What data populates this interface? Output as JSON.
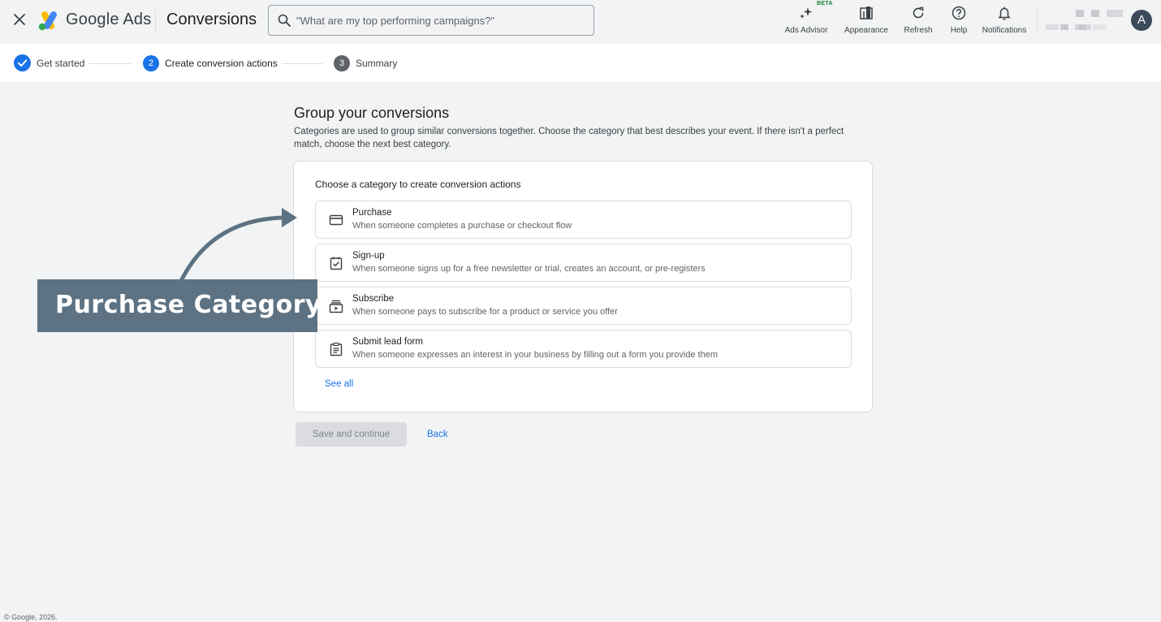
{
  "header": {
    "product_name": "Google Ads",
    "page_name": "Conversions",
    "search_placeholder": "\"What are my top performing campaigns?\"",
    "tools": [
      {
        "label": "Ads Advisor",
        "icon": "sparkle-icon"
      },
      {
        "label": "Appearance",
        "icon": "appearance-icon"
      },
      {
        "label": "Refresh",
        "icon": "refresh-icon"
      },
      {
        "label": "Help",
        "icon": "help-icon"
      },
      {
        "label": "Notifications",
        "icon": "bell-icon"
      }
    ],
    "beta_badge": "BETA",
    "avatar_letter": "A",
    "colors": {
      "google_blue": "#4285f4",
      "google_red": "#ea4335",
      "google_yellow": "#fbbc04",
      "google_green": "#34a853"
    }
  },
  "stepper": {
    "steps": [
      {
        "number": "1",
        "label": "Get started",
        "state": "complete"
      },
      {
        "number": "2",
        "label": "Create conversion actions",
        "state": "active"
      },
      {
        "number": "3",
        "label": "Summary",
        "state": "upcoming"
      }
    ],
    "colors": {
      "active": "#1a73e8",
      "upcoming": "#5f6368"
    }
  },
  "main": {
    "title": "Group your conversions",
    "description": "Categories are used to group similar conversions together. Choose the category that best describes your event. If there isn't a perfect match, choose the next best category.",
    "card": {
      "title": "Choose a category to create conversion actions",
      "options": [
        {
          "title": "Purchase",
          "description": "When someone completes a purchase or checkout flow",
          "icon": "credit-card-icon"
        },
        {
          "title": "Sign-up",
          "description": "When someone signs up for a free newsletter or trial, creates an account, or pre-registers",
          "icon": "checkbox-clipboard-icon"
        },
        {
          "title": "Subscribe",
          "description": "When someone pays to subscribe for a product or service you offer",
          "icon": "subscription-icon"
        },
        {
          "title": "Submit lead form",
          "description": "When someone expresses an interest in your business by filling out a form you provide them",
          "icon": "form-clipboard-icon"
        }
      ],
      "see_all": "See all"
    },
    "save_button": "Save and continue",
    "back_link": "Back"
  },
  "annotation": {
    "label": "Purchase Category",
    "color": "#5d7282"
  },
  "footer": {
    "copyright": "© Google, 2026."
  }
}
